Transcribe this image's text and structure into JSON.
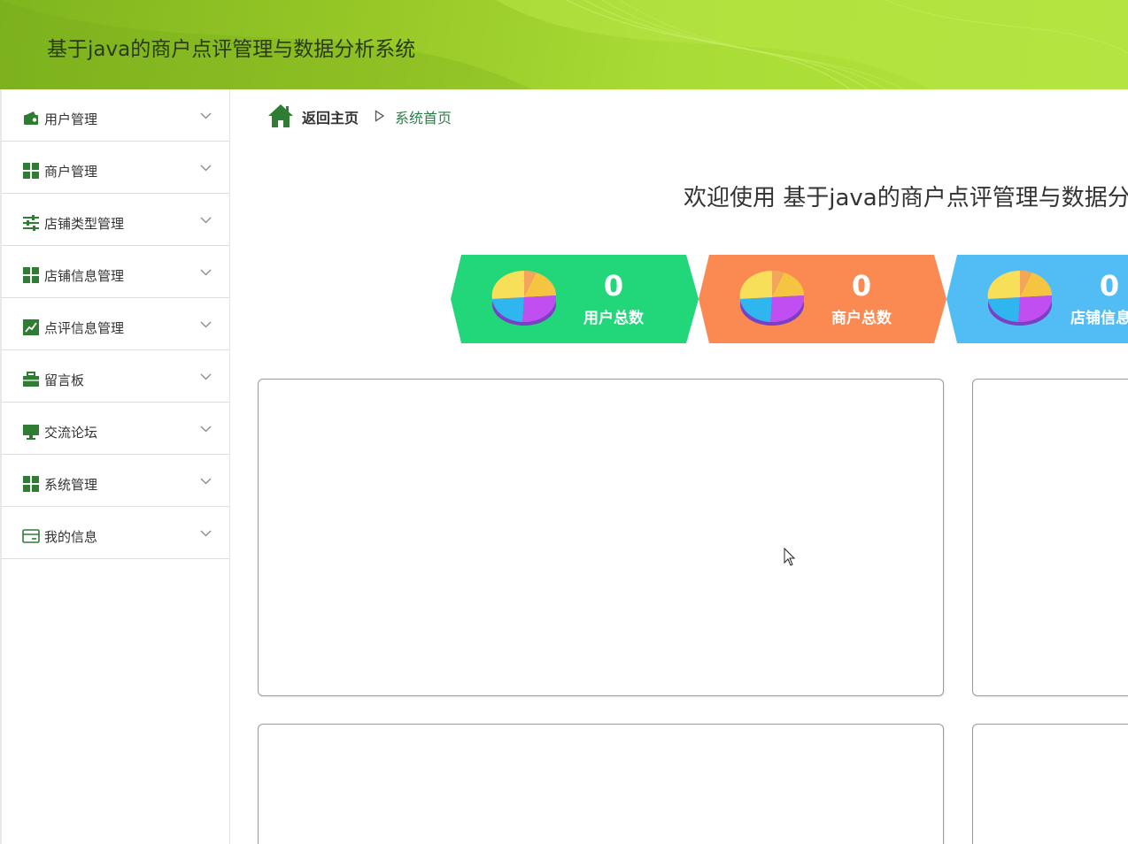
{
  "app": {
    "title": "基于java的商户点评管理与数据分析系统"
  },
  "sidebar": {
    "items": [
      {
        "label": "用户管理",
        "icon": "wallet-icon"
      },
      {
        "label": "商户管理",
        "icon": "grid-icon"
      },
      {
        "label": "店铺类型管理",
        "icon": "sliders-icon"
      },
      {
        "label": "店铺信息管理",
        "icon": "grid-icon"
      },
      {
        "label": "点评信息管理",
        "icon": "chart-line-icon"
      },
      {
        "label": "留言板",
        "icon": "briefcase-icon"
      },
      {
        "label": "交流论坛",
        "icon": "monitor-icon"
      },
      {
        "label": "系统管理",
        "icon": "grid-icon"
      },
      {
        "label": "我的信息",
        "icon": "card-icon"
      }
    ]
  },
  "breadcrumb": {
    "home_label": "返回主页",
    "separator": "▷",
    "current": "系统首页"
  },
  "main": {
    "welcome": "欢迎使用 基于java的商户点评管理与数据分析系统"
  },
  "stats": [
    {
      "value": "0",
      "label": "用户总数",
      "color": "#22d67a"
    },
    {
      "value": "0",
      "label": "商户总数",
      "color": "#fb8a52"
    },
    {
      "value": "0",
      "label": "店铺信息总数",
      "color": "#52bdf5"
    }
  ],
  "colors": {
    "accent_green": "#2e7d32",
    "header_green": "#98c928"
  }
}
